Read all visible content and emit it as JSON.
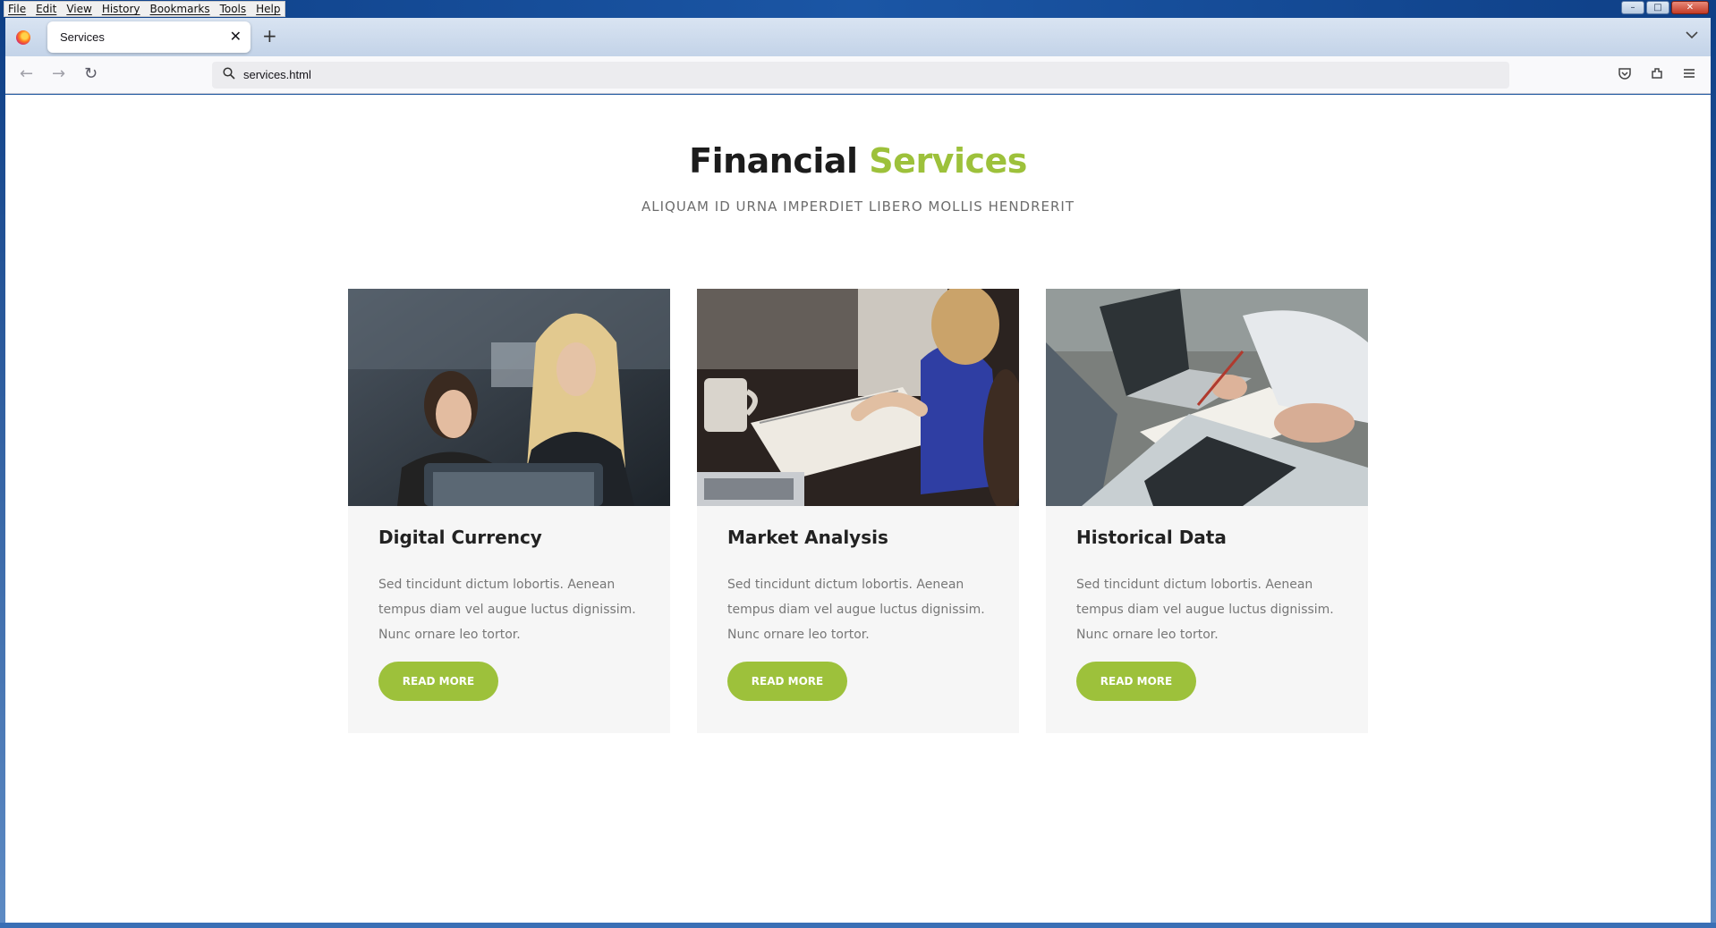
{
  "menu": [
    "File",
    "Edit",
    "View",
    "History",
    "Bookmarks",
    "Tools",
    "Help"
  ],
  "window_controls": {
    "minimize": "–",
    "maximize": "□",
    "close": "✕"
  },
  "tab": {
    "title": "Services",
    "close": "✕"
  },
  "newtab": "+",
  "nav": {
    "back": "←",
    "forward": "→",
    "reload": "↻"
  },
  "urlbar": {
    "value": "services.html"
  },
  "page": {
    "title_main": "Financial",
    "title_accent": "Services",
    "subtitle": "ALIQUAM ID URNA IMPERDIET LIBERO MOLLIS HENDRERIT"
  },
  "cards": [
    {
      "title": "Digital Currency",
      "text": "Sed tincidunt dictum lobortis. Aenean tempus diam vel augue luctus dignissim. Nunc ornare leo tortor.",
      "button": "READ MORE"
    },
    {
      "title": "Market Analysis",
      "text": "Sed tincidunt dictum lobortis. Aenean tempus diam vel augue luctus dignissim. Nunc ornare leo tortor.",
      "button": "READ MORE"
    },
    {
      "title": "Historical Data",
      "text": "Sed tincidunt dictum lobortis. Aenean tempus diam vel augue luctus dignissim. Nunc ornare leo tortor.",
      "button": "READ MORE"
    }
  ],
  "colors": {
    "accent": "#9dc13b",
    "card_bg": "#f6f6f6"
  }
}
